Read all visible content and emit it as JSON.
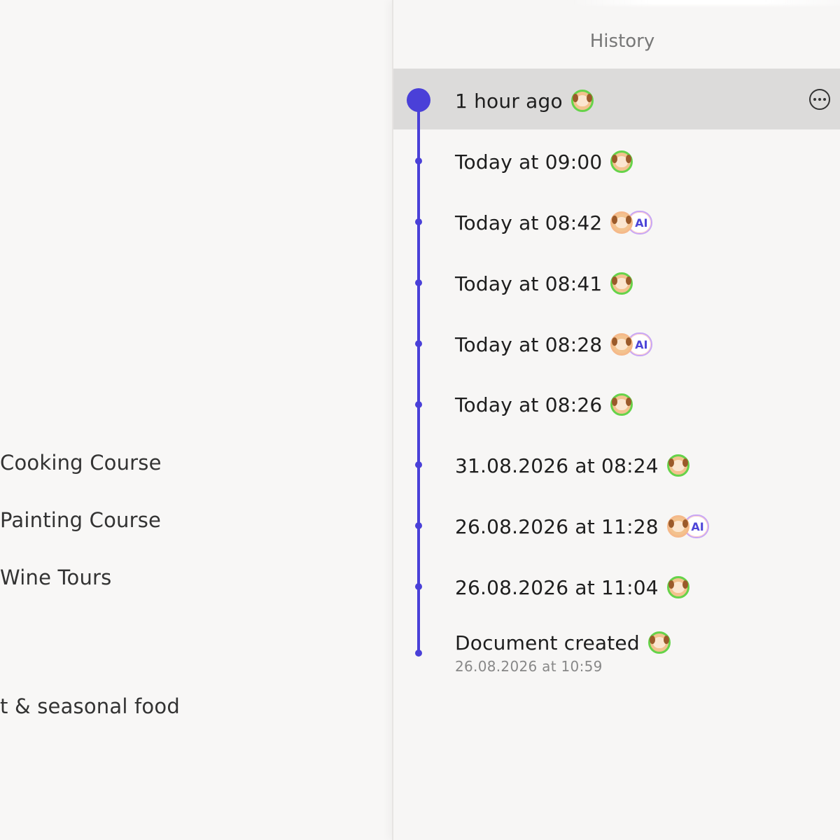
{
  "document": {
    "lines": [
      "Cooking Course",
      "Painting Course",
      "Wine Tours",
      "t & seasonal food"
    ]
  },
  "history": {
    "title": "History",
    "entries": [
      {
        "label": "1 hour ago",
        "ai": false,
        "selected": true
      },
      {
        "label": "Today at 09:00",
        "ai": false
      },
      {
        "label": "Today at 08:42",
        "ai": true
      },
      {
        "label": "Today at 08:41",
        "ai": false
      },
      {
        "label": "Today at 08:28",
        "ai": true
      },
      {
        "label": "Today at 08:26",
        "ai": false
      },
      {
        "label": "31.08.2026 at 08:24",
        "ai": false
      },
      {
        "label": "26.08.2026 at 11:28",
        "ai": true
      },
      {
        "label": "26.08.2026 at 11:04",
        "ai": false
      },
      {
        "label": "Document created",
        "ai": false,
        "subtitle": "26.08.2026 at 10:59"
      }
    ],
    "ai_badge": "AI",
    "avatar_icon": "dog-avatar-icon",
    "more_icon": "more-options-icon"
  },
  "colors": {
    "timeline": "#4a40d8",
    "highlight": "#dcdbda",
    "avatar_ring": "#66d34a"
  }
}
